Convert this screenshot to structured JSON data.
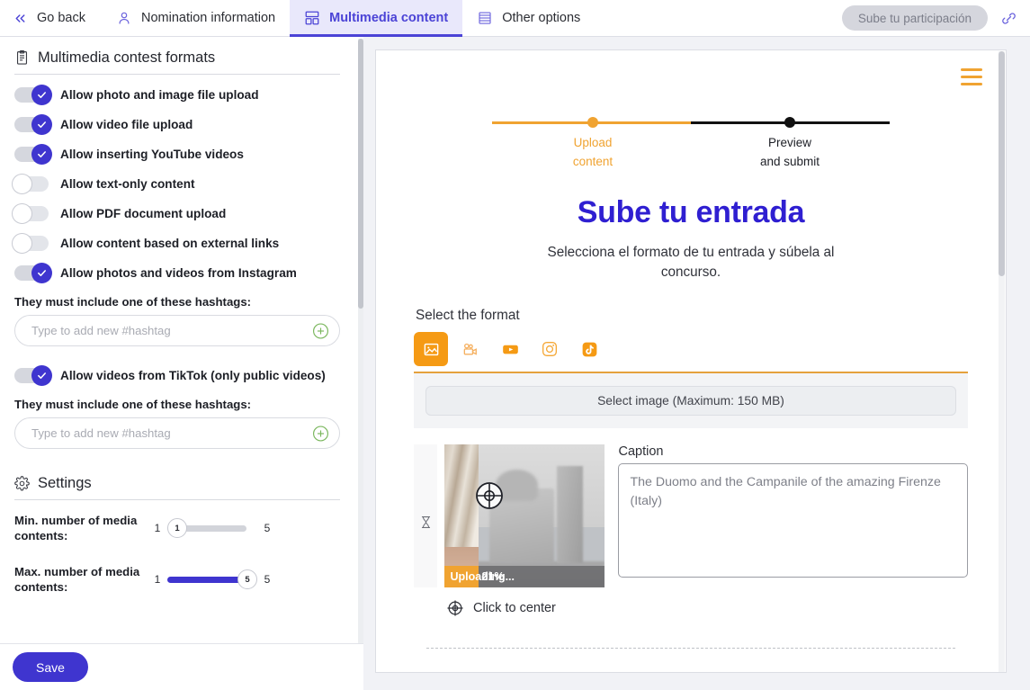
{
  "topbar": {
    "go_back": "Go back",
    "tabs": [
      {
        "label": "Nomination information",
        "icon": "user-icon",
        "active": false
      },
      {
        "label": "Multimedia content",
        "icon": "layout-icon",
        "active": true
      },
      {
        "label": "Other options",
        "icon": "list-icon",
        "active": false
      }
    ],
    "submit_label": "Sube tu participación",
    "link_icon": "link-icon",
    "accent": "#4b43d6"
  },
  "sidebar": {
    "formats_section": {
      "title": "Multimedia contest formats",
      "icon": "clipboard-icon",
      "toggles": [
        {
          "label": "Allow photo and image file upload",
          "on": true
        },
        {
          "label": "Allow video file upload",
          "on": true
        },
        {
          "label": "Allow inserting YouTube videos",
          "on": true
        },
        {
          "label": "Allow text-only content",
          "on": false
        },
        {
          "label": "Allow PDF document upload",
          "on": false
        },
        {
          "label": "Allow content based on external links",
          "on": false
        },
        {
          "label": "Allow photos and videos from Instagram",
          "on": true
        }
      ],
      "instagram_hashtag_label": "They must include one of these hashtags:",
      "instagram_hashtag_placeholder": "Type to add new #hashtag",
      "instagram_hashtag_value": "",
      "tiktok_toggle": {
        "label": "Allow videos from TikTok (only public videos)",
        "on": true
      },
      "tiktok_hashtag_label": "They must include one of these hashtags:",
      "tiktok_hashtag_placeholder": "Type to add new #hashtag",
      "tiktok_hashtag_value": ""
    },
    "settings_section": {
      "title": "Settings",
      "icon": "gear-icon",
      "sliders": [
        {
          "label": "Min. number of media contents:",
          "min": "1",
          "max": "5",
          "value": "1",
          "filled": false
        },
        {
          "label": "Max. number of media contents:",
          "min": "1",
          "max": "5",
          "value": "5",
          "filled": true
        }
      ]
    },
    "save_label": "Save",
    "toggle_on_color": "#3f35cf"
  },
  "preview": {
    "menu_icon": "hamburger-icon",
    "stepper": {
      "steps": [
        {
          "label_line1": "Upload",
          "label_line2": "content",
          "state": "active",
          "color": "#f0a331"
        },
        {
          "label_line1": "Preview",
          "label_line2": "and submit",
          "state": "inactive",
          "color": "#111111"
        }
      ]
    },
    "title": "Sube tu entrada",
    "subtitle": "Selecciona el formato de tu entrada y súbela al concurso.",
    "select_format_label": "Select the format",
    "format_buttons": [
      {
        "icon": "image-icon",
        "active": true
      },
      {
        "icon": "video-camera-icon",
        "active": false
      },
      {
        "icon": "youtube-icon",
        "active": false
      },
      {
        "icon": "instagram-icon",
        "active": false
      },
      {
        "icon": "tiktok-icon",
        "active": false
      }
    ],
    "select_image_button": "Select image  (Maximum: 150 MB)",
    "media_item": {
      "drag_icon": "hourglass-icon",
      "center_icon": "crosshair-icon",
      "upload_text": "Uploading...",
      "progress_percent": "21%",
      "progress_value": 21,
      "caption_label": "Caption",
      "caption_value": "The Duomo and the Campanile of the amazing Firenze (Italy)",
      "click_to_center": "Click to center",
      "click_to_center_icon": "crosshair-icon"
    }
  }
}
